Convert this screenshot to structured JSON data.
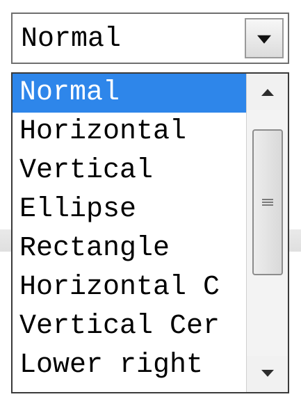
{
  "combobox": {
    "selected_value": "Normal",
    "button_icon": "chevron-down-icon"
  },
  "dropdown": {
    "items": [
      {
        "label": "Normal",
        "selected": true
      },
      {
        "label": "Horizontal",
        "selected": false
      },
      {
        "label": "Vertical",
        "selected": false
      },
      {
        "label": "Ellipse",
        "selected": false
      },
      {
        "label": "Rectangle",
        "selected": false
      },
      {
        "label": "Horizontal C",
        "selected": false
      },
      {
        "label": "Vertical Cer",
        "selected": false
      },
      {
        "label": "Lower right",
        "selected": false
      }
    ],
    "scrollbar": {
      "up_icon": "scroll-up-arrow-icon",
      "down_icon": "scroll-down-arrow-icon",
      "thumb_icon": "scroll-grip-icon"
    }
  },
  "colors": {
    "selection_background": "#2e86ea",
    "selection_text": "#ffffff",
    "text": "#000000"
  }
}
